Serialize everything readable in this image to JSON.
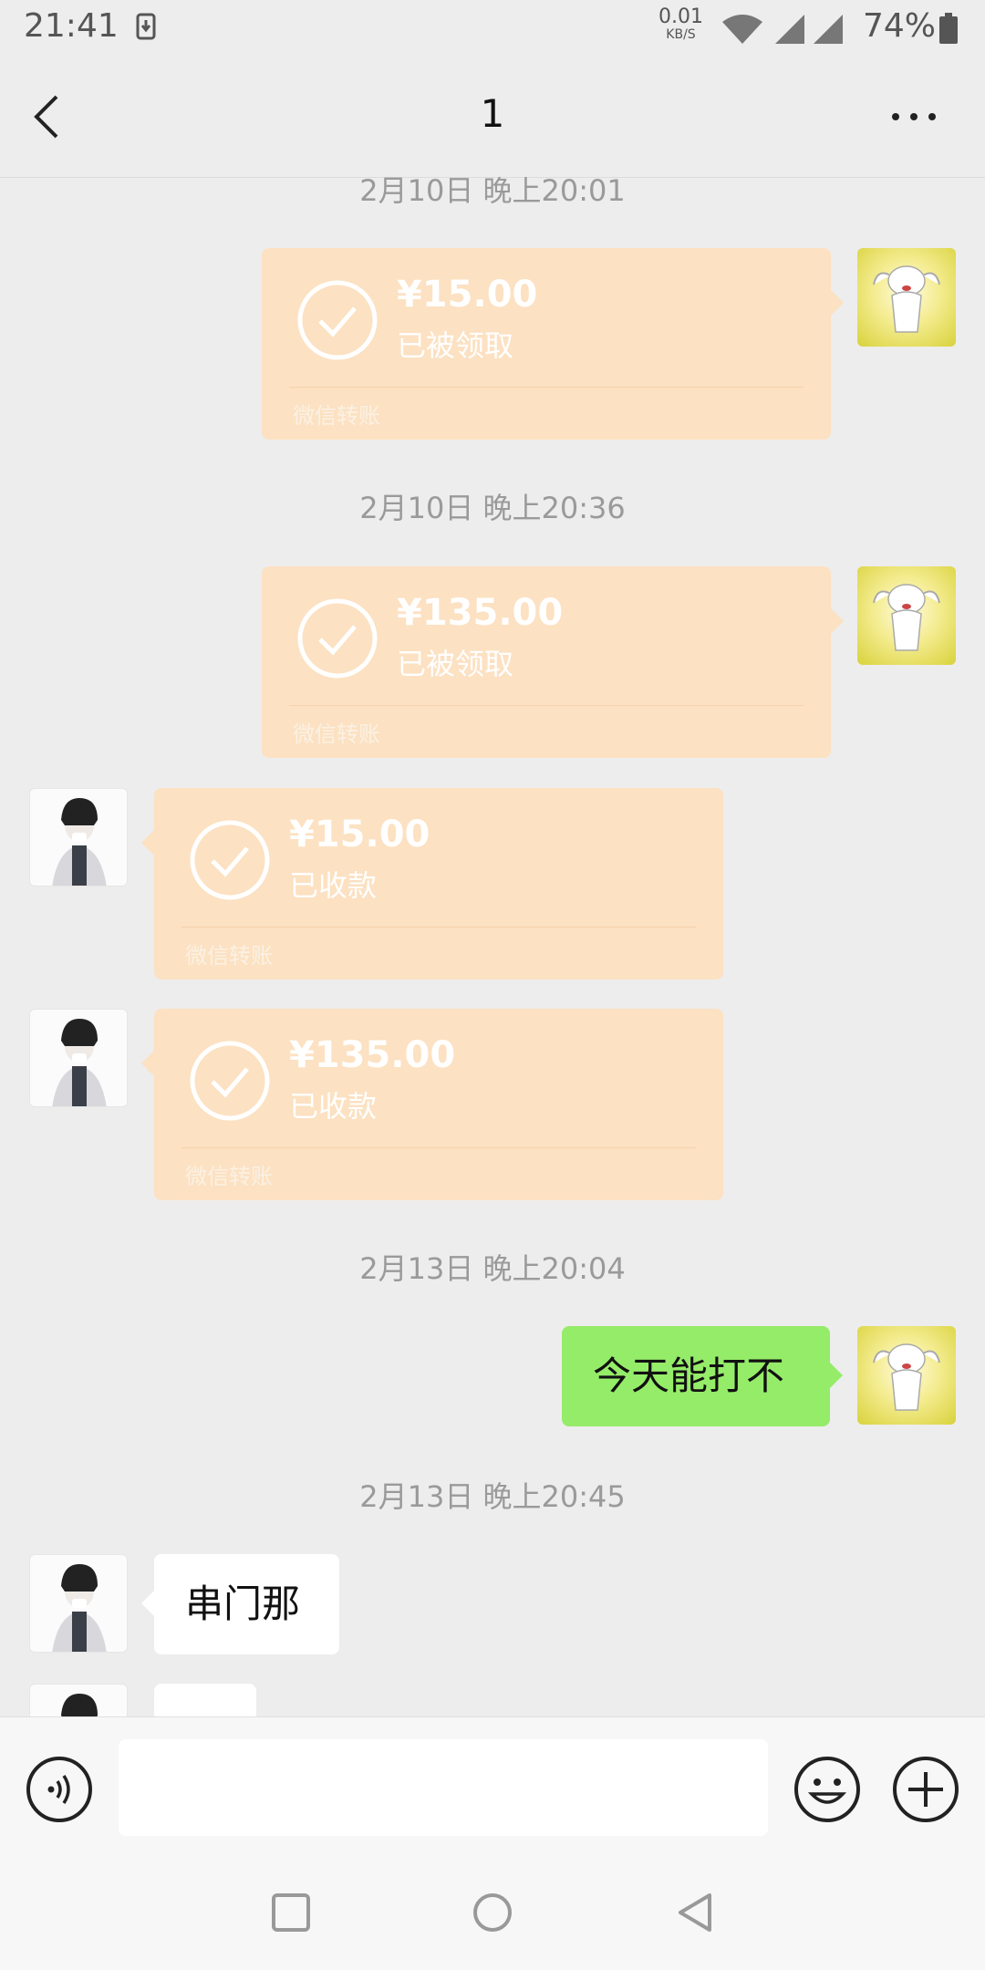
{
  "status_bar": {
    "time": "21:41",
    "speed_value": "0.01",
    "speed_unit": "KB/S",
    "battery": "74%"
  },
  "header": {
    "title": "1",
    "back_icon": "back-chevron-icon",
    "more_icon": "more-dots-icon"
  },
  "messages": {
    "ts1": "2月10日 晚上20:01",
    "m1": {
      "amount": "¥15.00",
      "state": "已被领取",
      "label": "微信转账"
    },
    "ts2": "2月10日 晚上20:36",
    "m2": {
      "amount": "¥135.00",
      "state": "已被领取",
      "label": "微信转账"
    },
    "m3": {
      "amount": "¥15.00",
      "state": "已收款",
      "label": "微信转账"
    },
    "m4": {
      "amount": "¥135.00",
      "state": "已收款",
      "label": "微信转账"
    },
    "ts3": "2月13日 晚上20:04",
    "m5": {
      "text": "今天能打不"
    },
    "ts4": "2月13日 晚上20:45",
    "m6": {
      "text": "串门那"
    }
  },
  "input_bar": {
    "message_value": "",
    "voice_icon": "voice-icon",
    "emoji_icon": "emoji-icon",
    "plus_icon": "plus-icon"
  },
  "nav_bar": {
    "recent_icon": "recent-apps-icon",
    "home_icon": "home-icon",
    "back_icon": "back-triangle-icon"
  },
  "colors": {
    "transfer_bg": "#fce1c2",
    "green_bubble": "#95ec69",
    "chat_bg": "#ededed"
  }
}
